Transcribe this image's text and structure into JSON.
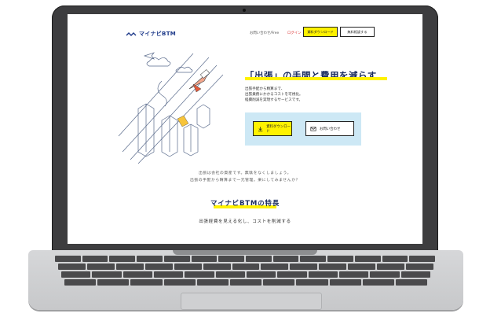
{
  "nav": {
    "logo_text": "マイナビBTM",
    "links": [
      "お問い合わせ/Free",
      "ログイン"
    ],
    "cta_download": "資料ダウンロード",
    "cta_contact": "無料相談する"
  },
  "hero": {
    "headline": "「出張」の手間と費用を減らす",
    "sub_lines": [
      "出張手配から精算まで、",
      "出張業務にかかるコストを可視化。",
      "経費削減を実現するサービスです。"
    ],
    "download_label": "資料ダウンロード",
    "contact_label": "お問い合わせ"
  },
  "mid": {
    "line1": "出張は会社の資産です。無駄をなくしましょう。",
    "line2": "出張の手配から精算まで一元管理。楽にしてみませんか？"
  },
  "features": {
    "title": "マイナビBTMの特長",
    "subtitle": "出張経費を見える化し、コストを削減する"
  },
  "colors": {
    "accent_yellow": "#fff200",
    "brand_navy": "#1a2b5c",
    "cta_box_blue": "#cde8f5"
  }
}
